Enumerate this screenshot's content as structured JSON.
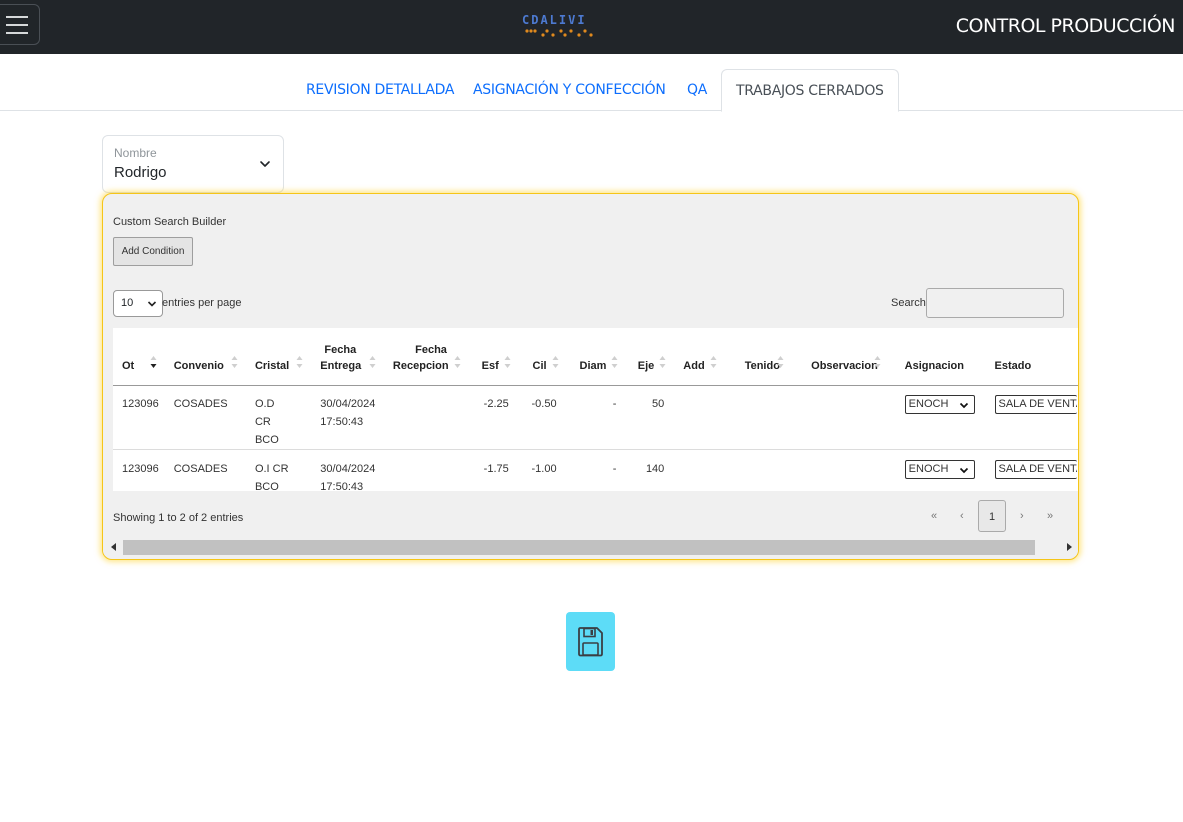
{
  "navbar": {
    "logo_text": "CDALIVI",
    "title": "CONTROL PRODUCCIÓN",
    "colors": {
      "background": "#212529",
      "logo_blue": "#4d7ad1",
      "logo_orange": "#e08a1e"
    }
  },
  "tabs": [
    {
      "label": "REVISION DETALLADA",
      "active": false
    },
    {
      "label": "ASIGNACIÓN Y CONFECCIÓN",
      "active": false
    },
    {
      "label": "QA",
      "active": false
    },
    {
      "label": "TRABAJOS CERRADOS",
      "active": true
    }
  ],
  "name_filter": {
    "label": "Nombre",
    "value": "Rodrigo"
  },
  "search_builder": {
    "title": "Custom Search Builder",
    "add_condition_label": "Add Condition"
  },
  "table_controls": {
    "page_length": "10",
    "page_length_label": "entries per page",
    "search_label": "Search:",
    "search_value": ""
  },
  "table": {
    "columns": [
      "Ot",
      "Convenio",
      "Cristal",
      "Fecha Entrega",
      "Fecha Recepcion",
      "Esf",
      "Cil",
      "Diam",
      "Eje",
      "Add",
      "Tenido",
      "Observacion",
      "Asignacion",
      "Estado"
    ],
    "rows": [
      {
        "ot": "123096",
        "convenio": "COSADES",
        "cristal": "O.D CR BCO",
        "fecha_entrega_date": "30/04/2024",
        "fecha_entrega_time": "17:50:43",
        "fecha_recepcion": "",
        "esf": "-2.25",
        "cil": "-0.50",
        "diam": "-",
        "eje": "50",
        "add": "",
        "tenido": "",
        "observacion": "",
        "asignacion": "ENOCH",
        "estado": "SALA DE VENTAS"
      },
      {
        "ot": "123096",
        "convenio": "COSADES",
        "cristal": "O.I CR BCO",
        "fecha_entrega_date": "30/04/2024",
        "fecha_entrega_time": "17:50:43",
        "fecha_recepcion": "",
        "esf": "-1.75",
        "cil": "-1.00",
        "diam": "-",
        "eje": "140",
        "add": "",
        "tenido": "",
        "observacion": "",
        "asignacion": "ENOCH",
        "estado": "SALA DE VENTAS"
      }
    ]
  },
  "info_text": "Showing 1 to 2 of 2 entries",
  "pagination": {
    "first": "«",
    "prev": "‹",
    "current": "1",
    "next": "›",
    "last": "»"
  },
  "save_button": {
    "icon": "floppy-disk-icon",
    "color": "#5ddcf7"
  }
}
